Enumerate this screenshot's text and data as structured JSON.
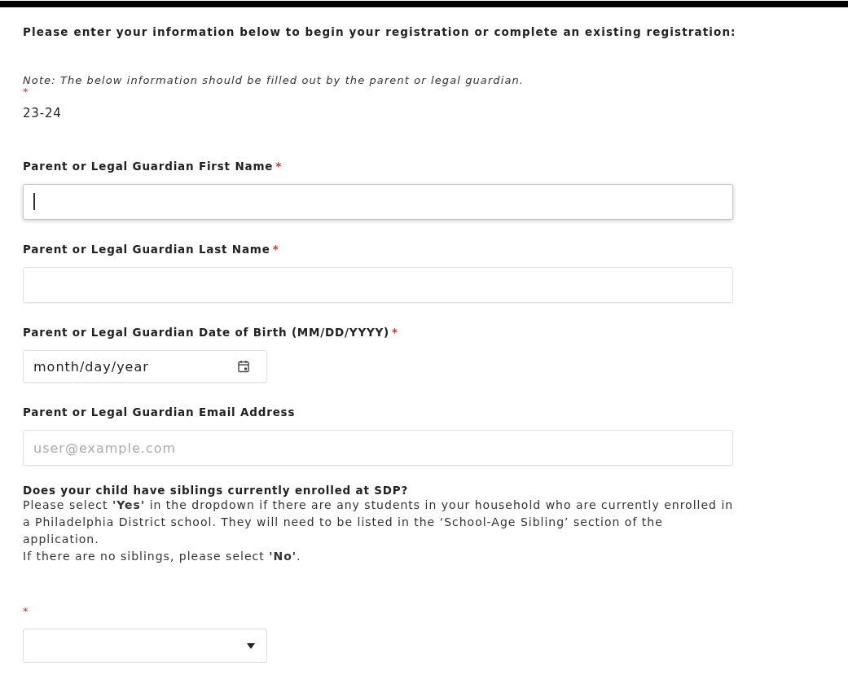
{
  "intro": "Please enter your information below to begin your registration or complete an existing registration:",
  "note": "Note: The below information should be filled out by the parent or legal guardian.",
  "year": {
    "required_mark": "*",
    "value": "23-24"
  },
  "fields": [
    {
      "kind": "text",
      "label": "Parent or Legal Guardian First Name",
      "required_mark": "*",
      "focused": true
    },
    {
      "kind": "text",
      "label": "Parent or Legal Guardian Last Name",
      "required_mark": "*",
      "focused": false
    },
    {
      "kind": "date",
      "label": "Parent or Legal Guardian Date of Birth (MM/DD/YYYY)",
      "required_mark": "*",
      "placeholder": "month/day/year",
      "focused": false
    },
    {
      "kind": "email",
      "label": "Parent or Legal Guardian Email Address",
      "placeholder": "user@example.com",
      "focused": false
    }
  ],
  "siblings": {
    "question": "Does your child have siblings currently enrolled at SDP?",
    "help": [
      "Please select **'Yes'** in the dropdown if there are any students in your household who are currently enrolled in a Philadelphia District school. They will need to be listed in the ‘School-Age Sibling’ section of the application.",
      "If there are no siblings, please select **'No'**."
    ],
    "required_mark": "*"
  }
}
